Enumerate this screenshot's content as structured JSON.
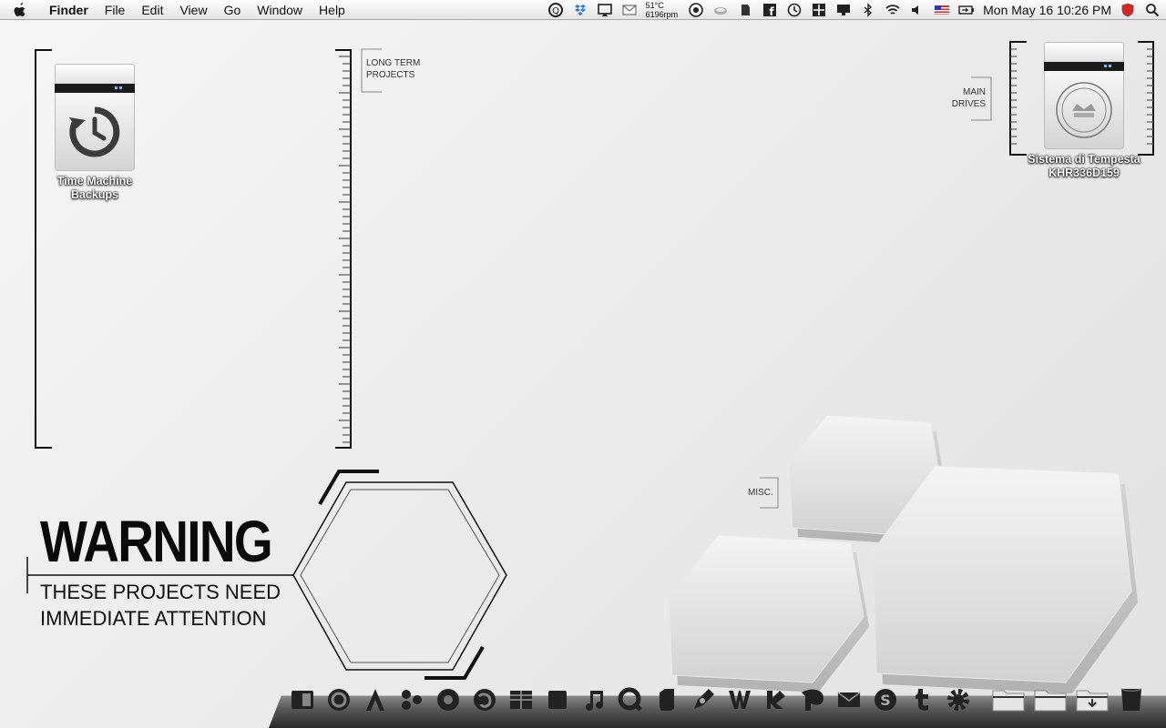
{
  "menubar": {
    "app_name": "Finder",
    "menus": [
      "File",
      "Edit",
      "View",
      "Go",
      "Window",
      "Help"
    ],
    "status": {
      "temperature": "51°C",
      "fan_speed": "6196rpm",
      "clock": "Mon May 16  10:26 PM",
      "icons": [
        "quicksilver-icon",
        "dropbox-icon",
        "airplay-icon",
        "mail-icon",
        "istat-icon",
        "coffee-cup-icon",
        "evernote-icon",
        "facebook-icon",
        "time-machine-icon",
        "menu-grid-icon",
        "display-icon",
        "bluetooth-icon",
        "wifi-icon",
        "volume-icon",
        "flag-icon",
        "battery-icon",
        "shield-icon",
        "spotlight-icon"
      ]
    }
  },
  "labels": {
    "long_term_projects": "LONG TERM\nPROJECTS",
    "main_drives": "MAIN\nDRIVES",
    "misc": "MISC."
  },
  "desktop_icons": {
    "time_machine": {
      "label": "Time Machine Backups",
      "icon": "time-machine-drive-icon"
    },
    "main_drive": {
      "label": "Sistema di Tempesta KHR336D159",
      "icon": "hard-drive-icon"
    }
  },
  "warning": {
    "title": "WARNING",
    "line1": "THESE PROJECTS NEED",
    "line2": "IMMEDIATE ATTENTION"
  },
  "dock": {
    "items": [
      "finder-icon",
      "safari-icon",
      "app-store-icon",
      "hex-app-icon",
      "chrome-icon",
      "firefox-icon",
      "grid-app-icon",
      "square-app-icon",
      "itunes-icon",
      "quicktime-icon",
      "evernote-icon",
      "pen-icon",
      "word-icon",
      "sketch-icon",
      "pages-icon",
      "mail-icon",
      "skype-icon",
      "tumblr-icon",
      "system-preferences-icon",
      "folder-applications-icon",
      "folder-documents-icon",
      "folder-downloads-icon",
      "trash-icon"
    ]
  }
}
